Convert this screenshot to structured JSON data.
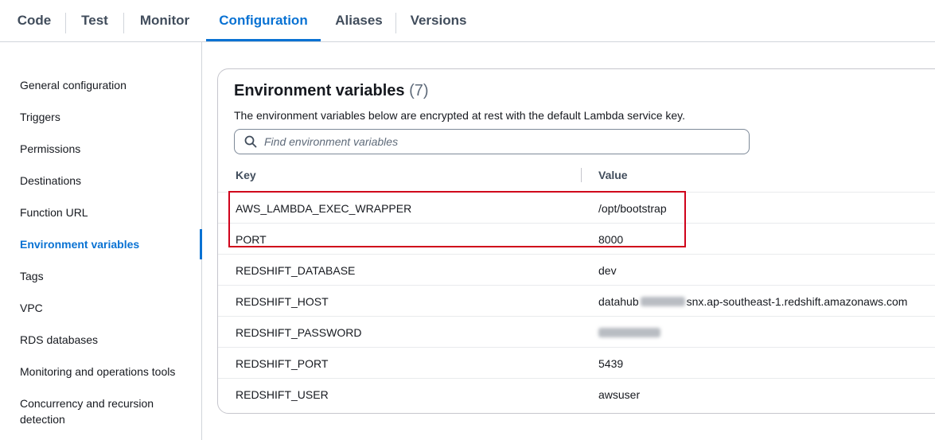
{
  "tabs": [
    {
      "label": "Code",
      "active": false
    },
    {
      "label": "Test",
      "active": false
    },
    {
      "label": "Monitor",
      "active": false
    },
    {
      "label": "Configuration",
      "active": true
    },
    {
      "label": "Aliases",
      "active": false
    },
    {
      "label": "Versions",
      "active": false
    }
  ],
  "sidebar": {
    "items": [
      {
        "label": "General configuration"
      },
      {
        "label": "Triggers"
      },
      {
        "label": "Permissions"
      },
      {
        "label": "Destinations"
      },
      {
        "label": "Function URL"
      },
      {
        "label": "Environment variables",
        "active": true
      },
      {
        "label": "Tags"
      },
      {
        "label": "VPC"
      },
      {
        "label": "RDS databases"
      },
      {
        "label": "Monitoring and operations tools"
      },
      {
        "label": "Concurrency and recursion detection"
      }
    ]
  },
  "panel": {
    "title": "Environment variables",
    "count": "(7)",
    "description": "The environment variables below are encrypted at rest with the default Lambda service key.",
    "search_placeholder": "Find environment variables",
    "columns": {
      "key": "Key",
      "value": "Value"
    },
    "rows": [
      {
        "key": "AWS_LAMBDA_EXEC_WRAPPER",
        "value": "/opt/bootstrap"
      },
      {
        "key": "PORT",
        "value": "8000"
      },
      {
        "key": "REDSHIFT_DATABASE",
        "value": "dev"
      },
      {
        "key": "REDSHIFT_HOST",
        "value_prefix": "datahub",
        "value_suffix": "snx.ap-southeast-1.redshift.amazonaws.com"
      },
      {
        "key": "REDSHIFT_PASSWORD",
        "value": ""
      },
      {
        "key": "REDSHIFT_PORT",
        "value": "5439"
      },
      {
        "key": "REDSHIFT_USER",
        "value": "awsuser"
      }
    ]
  },
  "colors": {
    "accent": "#0972d3",
    "highlight": "#d0021b"
  },
  "icons": {
    "search": "search-icon"
  }
}
